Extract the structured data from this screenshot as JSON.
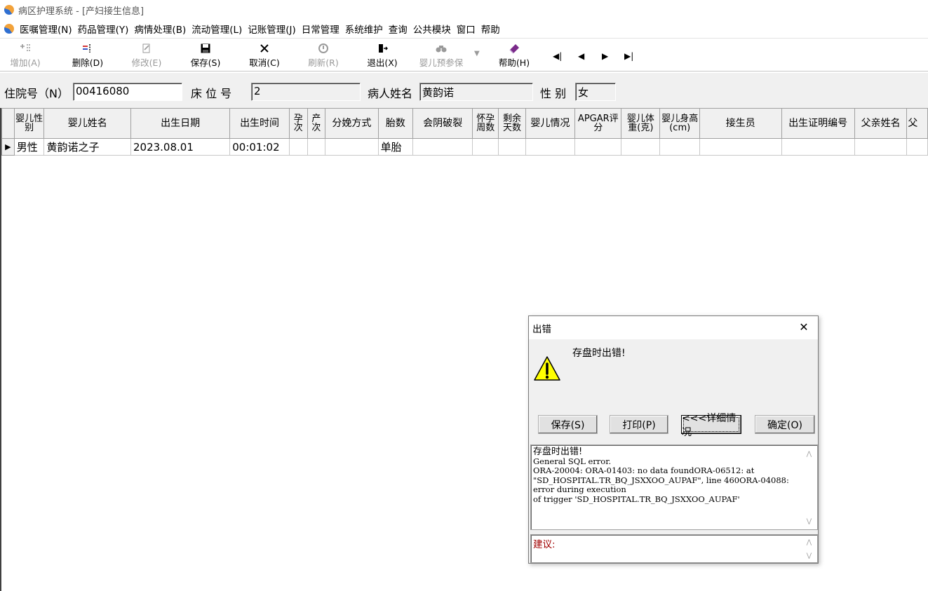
{
  "window": {
    "title": "病区护理系统 - [产妇接生信息]"
  },
  "menu": [
    "医嘱管理(N)",
    "药品管理(Y)",
    "病情处理(B)",
    "流动管理(L)",
    "记账管理(J)",
    "日常管理",
    "系统维护",
    "查询",
    "公共模块",
    "窗口",
    "帮助"
  ],
  "toolbar": {
    "add": "增加(A)",
    "delete": "删除(D)",
    "edit": "修改(E)",
    "save": "保存(S)",
    "cancel": "取消(C)",
    "refresh": "刷新(R)",
    "exit": "退出(X)",
    "insure": "婴儿预参保",
    "help": "帮助(H)"
  },
  "form": {
    "inpatient_label": "住院号（N）",
    "inpatient_value": "00416080",
    "bed_label": "床 位 号",
    "bed_value": "2",
    "name_label": "病人姓名",
    "name_value": "黄韵诺",
    "sex_label": "性 别",
    "sex_value": "女"
  },
  "grid": {
    "columns": [
      "婴儿性别",
      "婴儿姓名",
      "出生日期",
      "出生时间",
      "孕次",
      "产次",
      "分娩方式",
      "胎数",
      "会阴破裂",
      "怀孕周数",
      "剩余天数",
      "婴儿情况",
      "APGAR评分",
      "婴儿体重(克)",
      "婴儿身高(cm)",
      "接生员",
      "出生证明编号",
      "父亲姓名",
      "父"
    ],
    "rows": [
      {
        "sex": "男性",
        "name": "黄韵诺之子",
        "date": "2023.08.01",
        "time": "00:01:02",
        "gravida": "",
        "para": "",
        "delivery": "",
        "fetus": "单胎"
      }
    ]
  },
  "dialog": {
    "title": "出错",
    "message": "存盘时出错!",
    "buttons": {
      "save": "保存(S)",
      "print": "打印(P)",
      "details": "<<<详细情况",
      "ok": "确定(O)"
    },
    "detail_heading": "存盘时出错!",
    "detail_text": "General SQL error.\nORA-20004: ORA-01403: no data foundORA-06512: at \"SD_HOSPITAL.TR_BQ_JSXXOO_AUPAF\", line 460ORA-04088: error during execution\nof trigger 'SD_HOSPITAL.TR_BQ_JSXXOO_AUPAF'",
    "suggestion_label": "建议:"
  }
}
